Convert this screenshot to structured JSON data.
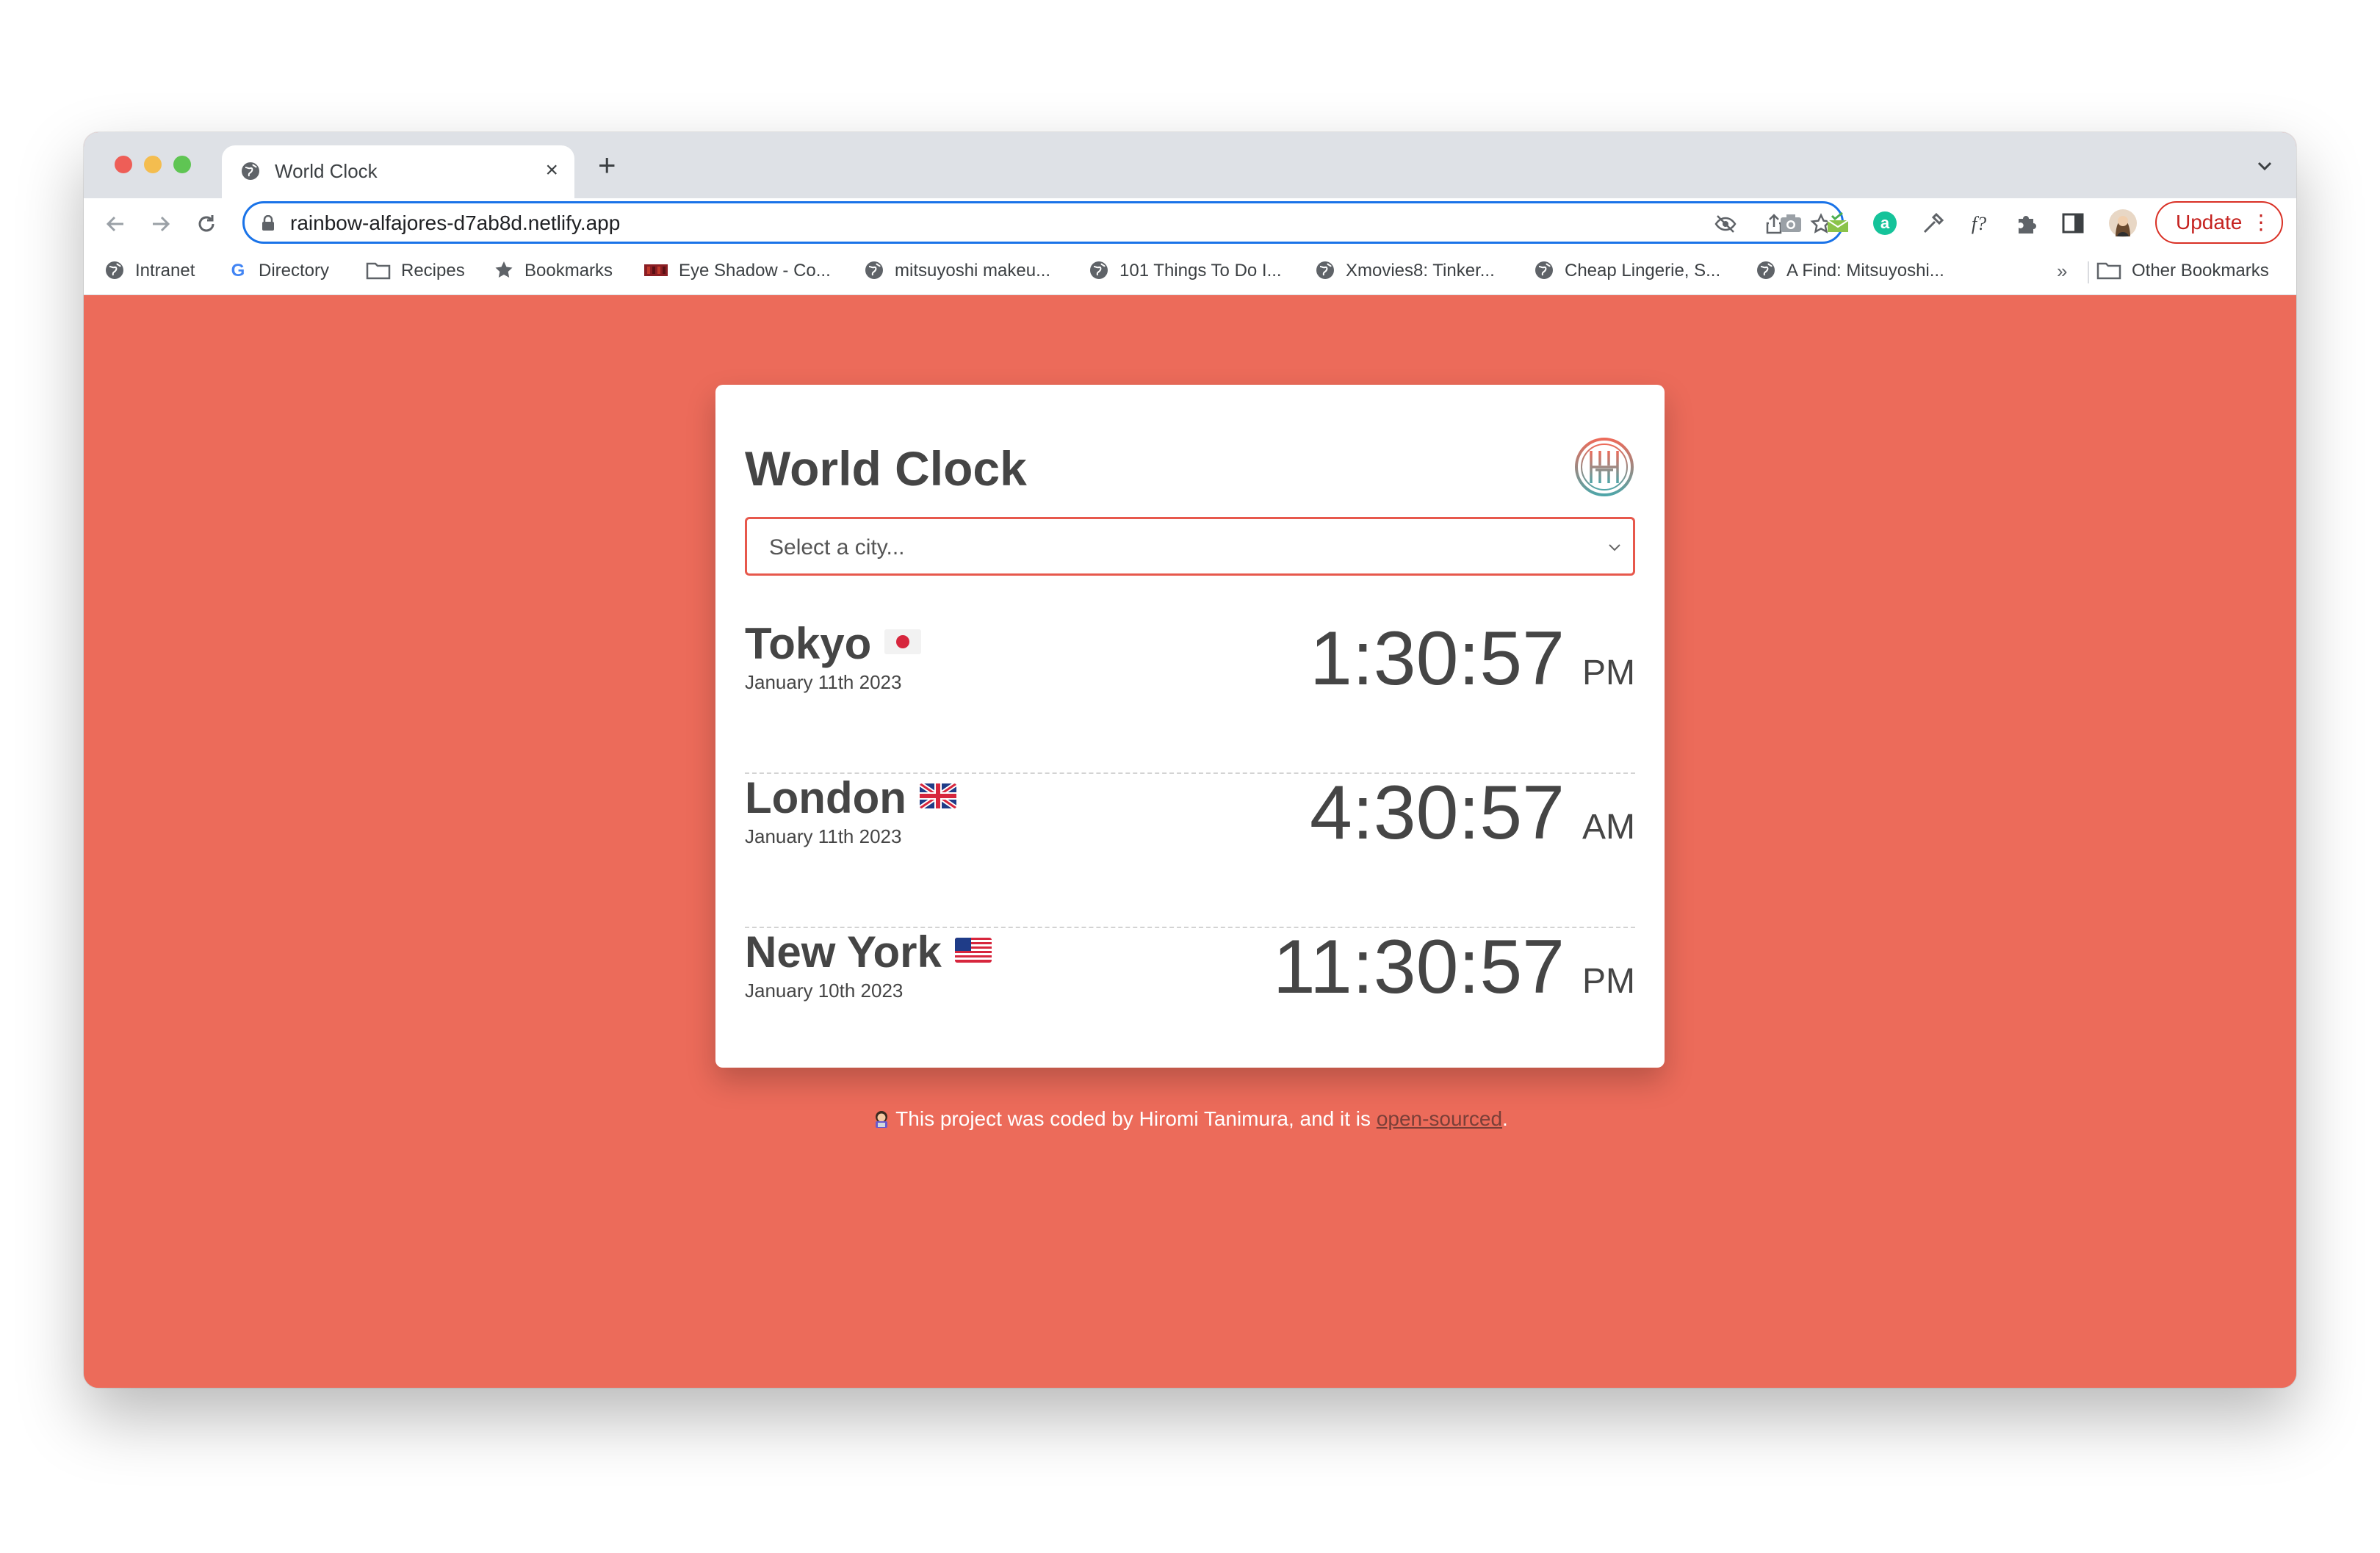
{
  "tab": {
    "title": "World Clock",
    "close": "×",
    "new_tab": "+"
  },
  "omnibox": {
    "url": "rainbow-alfajores-d7ab8d.netlify.app"
  },
  "toolbar": {
    "update_label": "Update",
    "menu_dots": "⋮"
  },
  "bookmarks": {
    "items": [
      {
        "label": "Intranet",
        "icon": "globe-icon"
      },
      {
        "label": "Directory",
        "icon": "google-icon"
      },
      {
        "label": "Recipes",
        "icon": "folder-icon"
      },
      {
        "label": "Bookmarks",
        "icon": "star-icon"
      },
      {
        "label": "Eye Shadow - Co...",
        "icon": "site-favicon"
      },
      {
        "label": "mitsuyoshi makeu...",
        "icon": "globe-icon"
      },
      {
        "label": "101 Things To Do I...",
        "icon": "globe-icon"
      },
      {
        "label": "Xmovies8: Tinker...",
        "icon": "globe-icon"
      },
      {
        "label": "Cheap Lingerie, S...",
        "icon": "globe-icon"
      },
      {
        "label": "A Find: Mitsuyoshi...",
        "icon": "globe-icon"
      }
    ],
    "overflow": "»",
    "other": "Other Bookmarks"
  },
  "app": {
    "title": "World Clock",
    "select_placeholder": "Select a city...",
    "cities": [
      {
        "name": "Tokyo",
        "date": "January 11th 2023",
        "time": "1:30:57",
        "ampm": "PM",
        "flag": "japan-flag"
      },
      {
        "name": "London",
        "date": "January 11th 2023",
        "time": "4:30:57",
        "ampm": "AM",
        "flag": "uk-flag"
      },
      {
        "name": "New York",
        "date": "January 10th 2023",
        "time": "11:30:57",
        "ampm": "PM",
        "flag": "us-flag"
      }
    ]
  },
  "footer": {
    "text_before": "This project was coded by Hiromi Tanimura, and it is ",
    "link": "open-sourced",
    "text_after": "."
  },
  "colors": {
    "page_bg": "#ec6b5a",
    "select_border": "#e7584c",
    "accent_blue": "#1a73e8",
    "update_red": "#d93025"
  }
}
